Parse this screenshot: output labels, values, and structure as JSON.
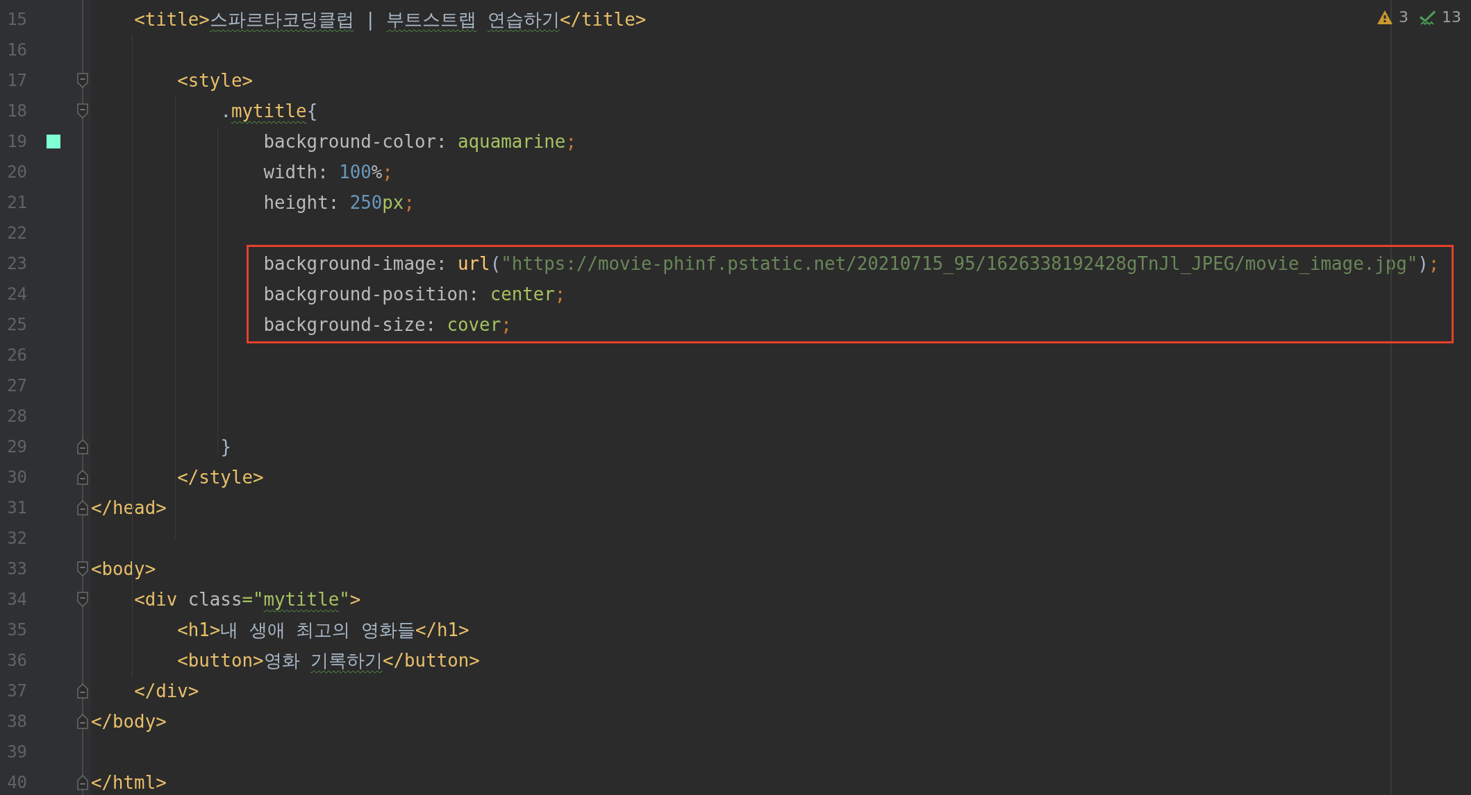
{
  "inspections": {
    "warnings": "3",
    "passed": "13"
  },
  "lines": [
    {
      "number": "15",
      "tokens": [
        {
          "kind": "tag",
          "text": "    <title>"
        },
        {
          "kind": "text",
          "text": "스파르타코딩클럽",
          "typo": true
        },
        {
          "kind": "text",
          "text": " | "
        },
        {
          "kind": "text",
          "text": "부트스트랩",
          "typo": true
        },
        {
          "kind": "text",
          "text": " 연습하기",
          "typo": true
        },
        {
          "kind": "tag",
          "text": "</title>"
        }
      ]
    },
    {
      "number": "16"
    },
    {
      "number": "17",
      "fold_open": true,
      "tokens": [
        {
          "kind": "tag",
          "text": "        <style>"
        }
      ]
    },
    {
      "number": "18",
      "fold_open": true,
      "tokens": [
        {
          "kind": "text",
          "text": "            ."
        },
        {
          "kind": "sel",
          "text": "mytitle",
          "typo": true
        },
        {
          "kind": "text",
          "text": "{"
        }
      ]
    },
    {
      "number": "19",
      "color": "#7fffd4",
      "tokens": [
        {
          "kind": "prop",
          "text": "                background-color: "
        },
        {
          "kind": "value",
          "text": "aquamarine"
        },
        {
          "kind": "punct",
          "text": ";"
        }
      ]
    },
    {
      "number": "20",
      "tokens": [
        {
          "kind": "prop",
          "text": "                width: "
        },
        {
          "kind": "num",
          "text": "100"
        },
        {
          "kind": "prop",
          "text": "%"
        },
        {
          "kind": "punct",
          "text": ";"
        }
      ]
    },
    {
      "number": "21",
      "tokens": [
        {
          "kind": "prop",
          "text": "                height: "
        },
        {
          "kind": "num",
          "text": "250"
        },
        {
          "kind": "value",
          "text": "px"
        },
        {
          "kind": "punct",
          "text": ";"
        }
      ]
    },
    {
      "number": "22"
    },
    {
      "number": "23",
      "highlighted": true,
      "tokens": [
        {
          "kind": "prop",
          "text": "                background-image: "
        },
        {
          "kind": "func",
          "text": "url"
        },
        {
          "kind": "text",
          "text": "("
        },
        {
          "kind": "str",
          "text": "\"https://movie-phinf.pstatic.net/20210715_95/1626338192428gTnJl_JPEG/movie_image.jpg\""
        },
        {
          "kind": "text",
          "text": ")"
        },
        {
          "kind": "punct",
          "text": ";"
        }
      ]
    },
    {
      "number": "24",
      "highlighted": true,
      "tokens": [
        {
          "kind": "prop",
          "text": "                background-position: "
        },
        {
          "kind": "value",
          "text": "center"
        },
        {
          "kind": "punct",
          "text": ";"
        }
      ]
    },
    {
      "number": "25",
      "highlighted": true,
      "tokens": [
        {
          "kind": "prop",
          "text": "                background-size: "
        },
        {
          "kind": "value",
          "text": "cover"
        },
        {
          "kind": "punct",
          "text": ";"
        }
      ]
    },
    {
      "number": "26"
    },
    {
      "number": "27"
    },
    {
      "number": "28"
    },
    {
      "number": "29",
      "fold_close": true,
      "tokens": [
        {
          "kind": "text",
          "text": "            }"
        }
      ]
    },
    {
      "number": "30",
      "fold_close": true,
      "tokens": [
        {
          "kind": "tag",
          "text": "        </style>"
        }
      ]
    },
    {
      "number": "31",
      "fold_close": true,
      "tokens": [
        {
          "kind": "tag",
          "text": "</head>"
        }
      ]
    },
    {
      "number": "32"
    },
    {
      "number": "33",
      "fold_open": true,
      "tokens": [
        {
          "kind": "tag",
          "text": "<body>"
        }
      ]
    },
    {
      "number": "34",
      "fold_open": true,
      "tokens": [
        {
          "kind": "tag",
          "text": "    <div "
        },
        {
          "kind": "prop",
          "text": "class"
        },
        {
          "kind": "value",
          "text": "=\""
        },
        {
          "kind": "value",
          "text": "mytitle",
          "typo": true
        },
        {
          "kind": "value",
          "text": "\""
        },
        {
          "kind": "tag",
          "text": ">"
        }
      ]
    },
    {
      "number": "35",
      "tokens": [
        {
          "kind": "tag",
          "text": "        <h1>"
        },
        {
          "kind": "text",
          "text": "내 생애 최고의 영화들"
        },
        {
          "kind": "tag",
          "text": "</h1>"
        }
      ]
    },
    {
      "number": "36",
      "tokens": [
        {
          "kind": "tag",
          "text": "        <button>"
        },
        {
          "kind": "text",
          "text": "영화 "
        },
        {
          "kind": "text",
          "text": "기록하기",
          "typo": true
        },
        {
          "kind": "tag",
          "text": "</button>"
        }
      ]
    },
    {
      "number": "37",
      "fold_close": true,
      "tokens": [
        {
          "kind": "tag",
          "text": "    </div>"
        }
      ]
    },
    {
      "number": "38",
      "fold_close": true,
      "tokens": [
        {
          "kind": "tag",
          "text": "</body>"
        }
      ]
    },
    {
      "number": "39"
    },
    {
      "number": "40",
      "fold_close": true,
      "tokens": [
        {
          "kind": "tag",
          "text": "</html>"
        }
      ]
    }
  ]
}
